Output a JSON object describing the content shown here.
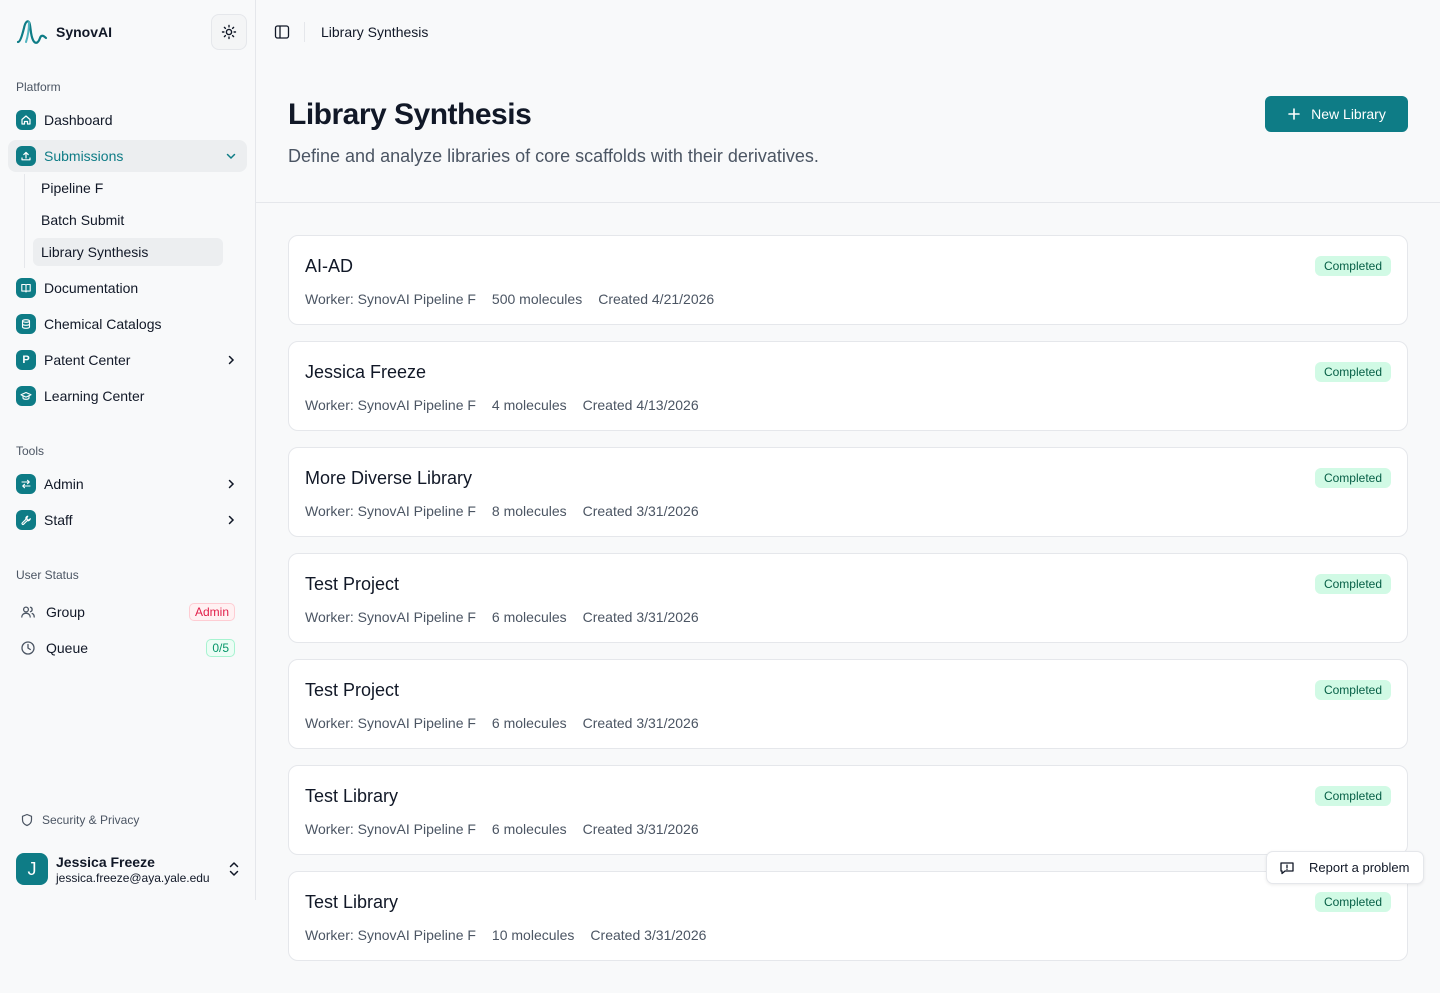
{
  "app": {
    "name": "SynovAI"
  },
  "sidebar": {
    "platform_label": "Platform",
    "platform_items": [
      {
        "label": "Dashboard",
        "icon": "home-icon"
      },
      {
        "label": "Submissions",
        "icon": "upload-icon"
      },
      {
        "label": "Documentation",
        "icon": "book-icon"
      },
      {
        "label": "Chemical Catalogs",
        "icon": "database-icon"
      },
      {
        "label": "Patent Center",
        "icon": "P"
      },
      {
        "label": "Learning Center",
        "icon": "graduation-cap-icon"
      }
    ],
    "submission_subitems": [
      {
        "label": "Pipeline F"
      },
      {
        "label": "Batch Submit"
      },
      {
        "label": "Library Synthesis"
      }
    ],
    "tools_label": "Tools",
    "tools_items": [
      {
        "label": "Admin",
        "icon": "arrows-icon"
      },
      {
        "label": "Staff",
        "icon": "wrench-icon"
      }
    ],
    "user_status_label": "User Status",
    "group": {
      "label": "Group",
      "badge": "Admin"
    },
    "queue": {
      "label": "Queue",
      "badge": "0/5"
    },
    "security_label": "Security & Privacy",
    "user": {
      "initial": "J",
      "name": "Jessica Freeze",
      "email": "jessica.freeze@aya.yale.edu"
    }
  },
  "topbar": {
    "breadcrumb": "Library Synthesis"
  },
  "header": {
    "title": "Library Synthesis",
    "subtitle": "Define and analyze libraries of core scaffolds with their derivatives.",
    "new_button": "New Library"
  },
  "libraries": [
    {
      "name": "AI-AD",
      "worker": "Worker: SynovAI Pipeline F",
      "molecules": "500 molecules",
      "created": "Created 4/21/2026",
      "status": "Completed"
    },
    {
      "name": "Jessica Freeze",
      "worker": "Worker: SynovAI Pipeline F",
      "molecules": "4 molecules",
      "created": "Created 4/13/2026",
      "status": "Completed"
    },
    {
      "name": "More Diverse Library",
      "worker": "Worker: SynovAI Pipeline F",
      "molecules": "8 molecules",
      "created": "Created 3/31/2026",
      "status": "Completed"
    },
    {
      "name": "Test Project",
      "worker": "Worker: SynovAI Pipeline F",
      "molecules": "6 molecules",
      "created": "Created 3/31/2026",
      "status": "Completed"
    },
    {
      "name": "Test Project",
      "worker": "Worker: SynovAI Pipeline F",
      "molecules": "6 molecules",
      "created": "Created 3/31/2026",
      "status": "Completed"
    },
    {
      "name": "Test Library",
      "worker": "Worker: SynovAI Pipeline F",
      "molecules": "6 molecules",
      "created": "Created 3/31/2026",
      "status": "Completed"
    },
    {
      "name": "Test Library",
      "worker": "Worker: SynovAI Pipeline F",
      "molecules": "10 molecules",
      "created": "Created 3/31/2026",
      "status": "Completed"
    }
  ],
  "report_button": "Report a problem",
  "colors": {
    "accent": "#0e7c86",
    "badge_green_bg": "#d1fae5",
    "badge_green_text": "#065f46",
    "admin_badge": "#e11d48"
  }
}
